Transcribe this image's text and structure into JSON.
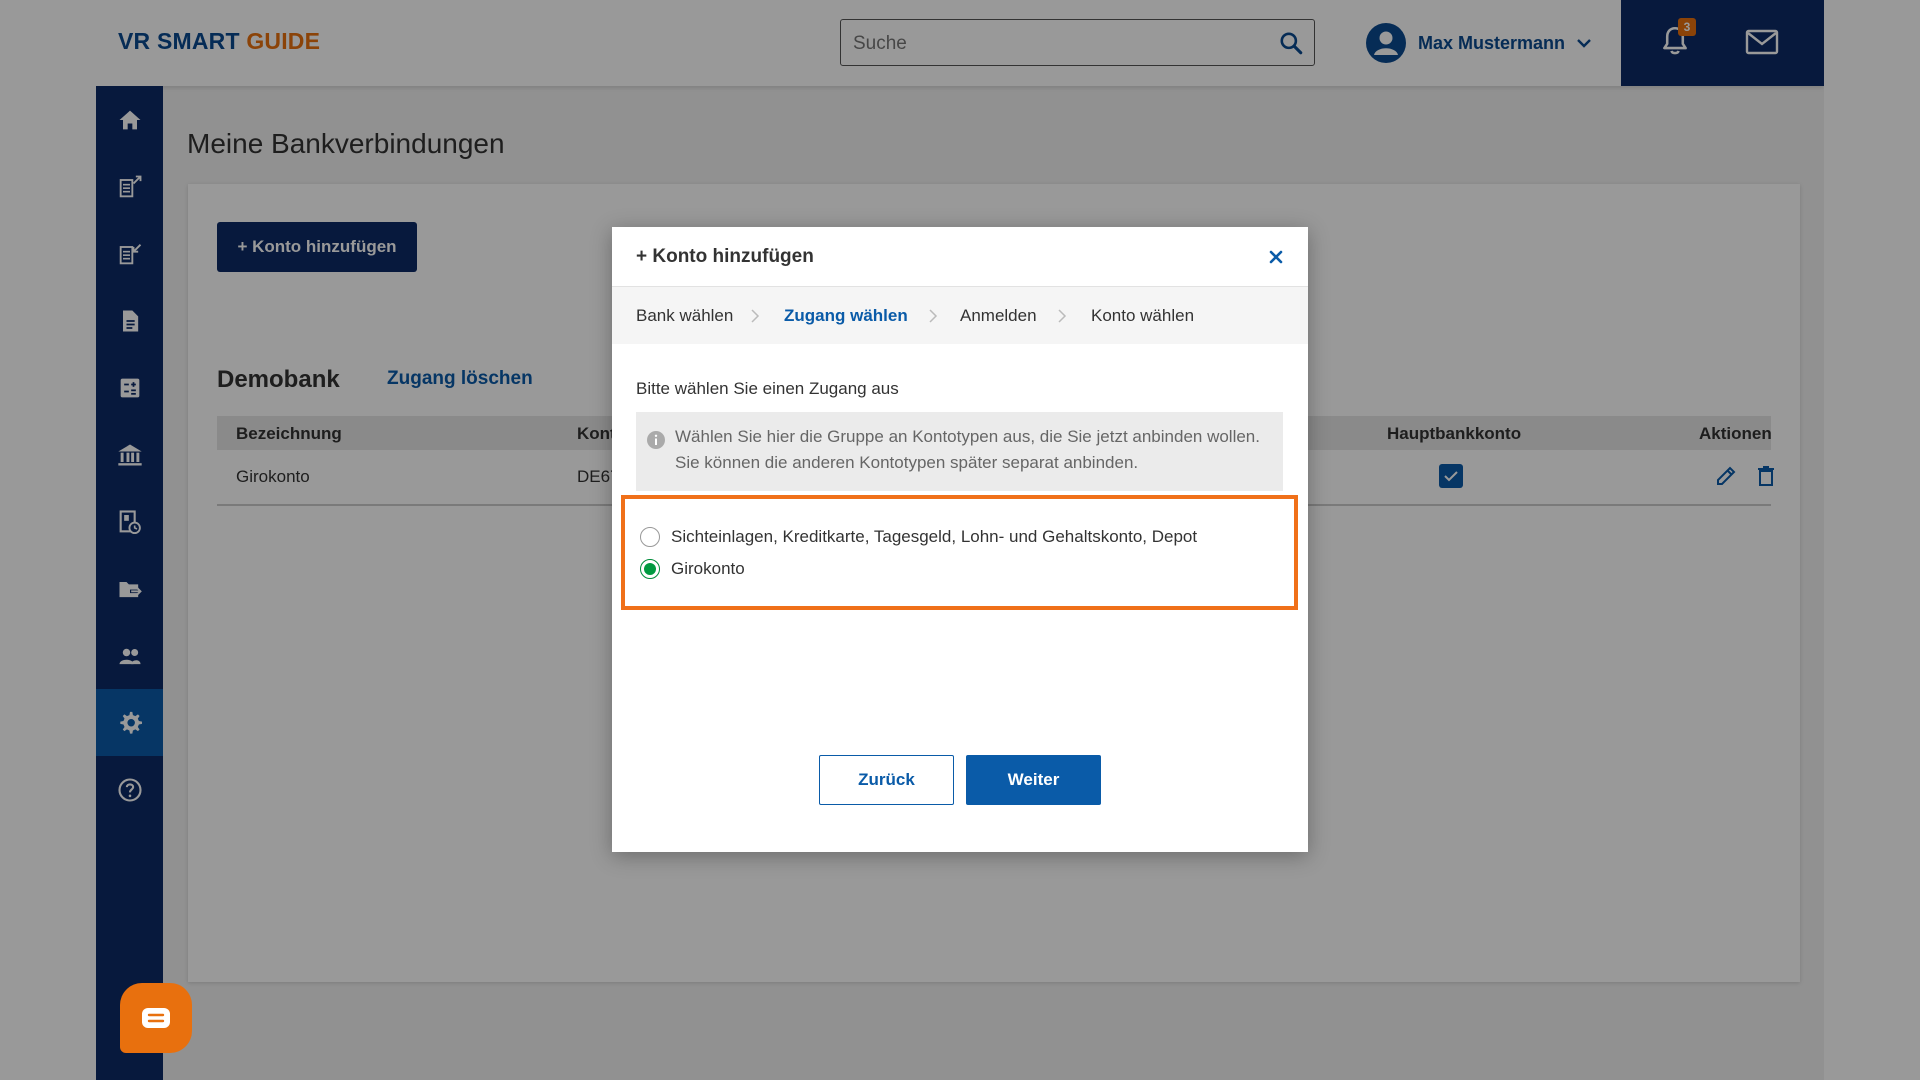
{
  "header": {
    "logo_part1": "VR SMART",
    "logo_part2": "GUIDE",
    "search_placeholder": "Suche",
    "user_name": "Max Mustermann",
    "notification_count": "3",
    "search_icon": "search-icon",
    "avatar_icon": "user-avatar-icon",
    "bell_icon": "bell-icon",
    "mail_icon": "mail-icon"
  },
  "sidebar": {
    "items": [
      {
        "icon": "home-icon"
      },
      {
        "icon": "outgoing-transfer-icon"
      },
      {
        "icon": "incoming-transfer-icon"
      },
      {
        "icon": "document-icon"
      },
      {
        "icon": "calculator-icon"
      },
      {
        "icon": "bank-icon"
      },
      {
        "icon": "report-icon"
      },
      {
        "icon": "folder-export-icon"
      },
      {
        "icon": "people-icon"
      },
      {
        "icon": "settings-icon",
        "active": true
      },
      {
        "icon": "help-icon"
      }
    ]
  },
  "page": {
    "title": "Meine Bankverbindungen",
    "add_account_button": "+ Konto hinzufügen",
    "bank": {
      "name": "Demobank",
      "delete_access_link": "Zugang löschen",
      "columns": [
        "Bezeichnung",
        "Kont",
        "Hauptbankkonto",
        "Aktionen"
      ],
      "rows": [
        {
          "name": "Girokonto",
          "account": "DE67",
          "main_account": true
        }
      ]
    }
  },
  "modal": {
    "title": "+ Konto hinzufügen",
    "steps": [
      "Bank wählen",
      "Zugang wählen",
      "Anmelden",
      "Konto wählen"
    ],
    "active_step": 1,
    "prompt": "Bitte wählen Sie einen Zugang aus",
    "info_text": "Wählen Sie hier die Gruppe an Kontotypen aus, die Sie jetzt anbinden wollen. Sie können die anderen Kontotypen später separat anbinden.",
    "options": [
      {
        "label": "Sichteinlagen, Kreditkarte, Tagesgeld, Lohn- und Gehaltskonto, Depot",
        "selected": false
      },
      {
        "label": "Girokonto",
        "selected": true
      }
    ],
    "back_button": "Zurück",
    "next_button": "Weiter"
  },
  "colors": {
    "brand_dark": "#0d2b66",
    "brand_blue": "#0a5ba8",
    "accent_orange": "#e8700e",
    "radio_green": "#009a40"
  }
}
